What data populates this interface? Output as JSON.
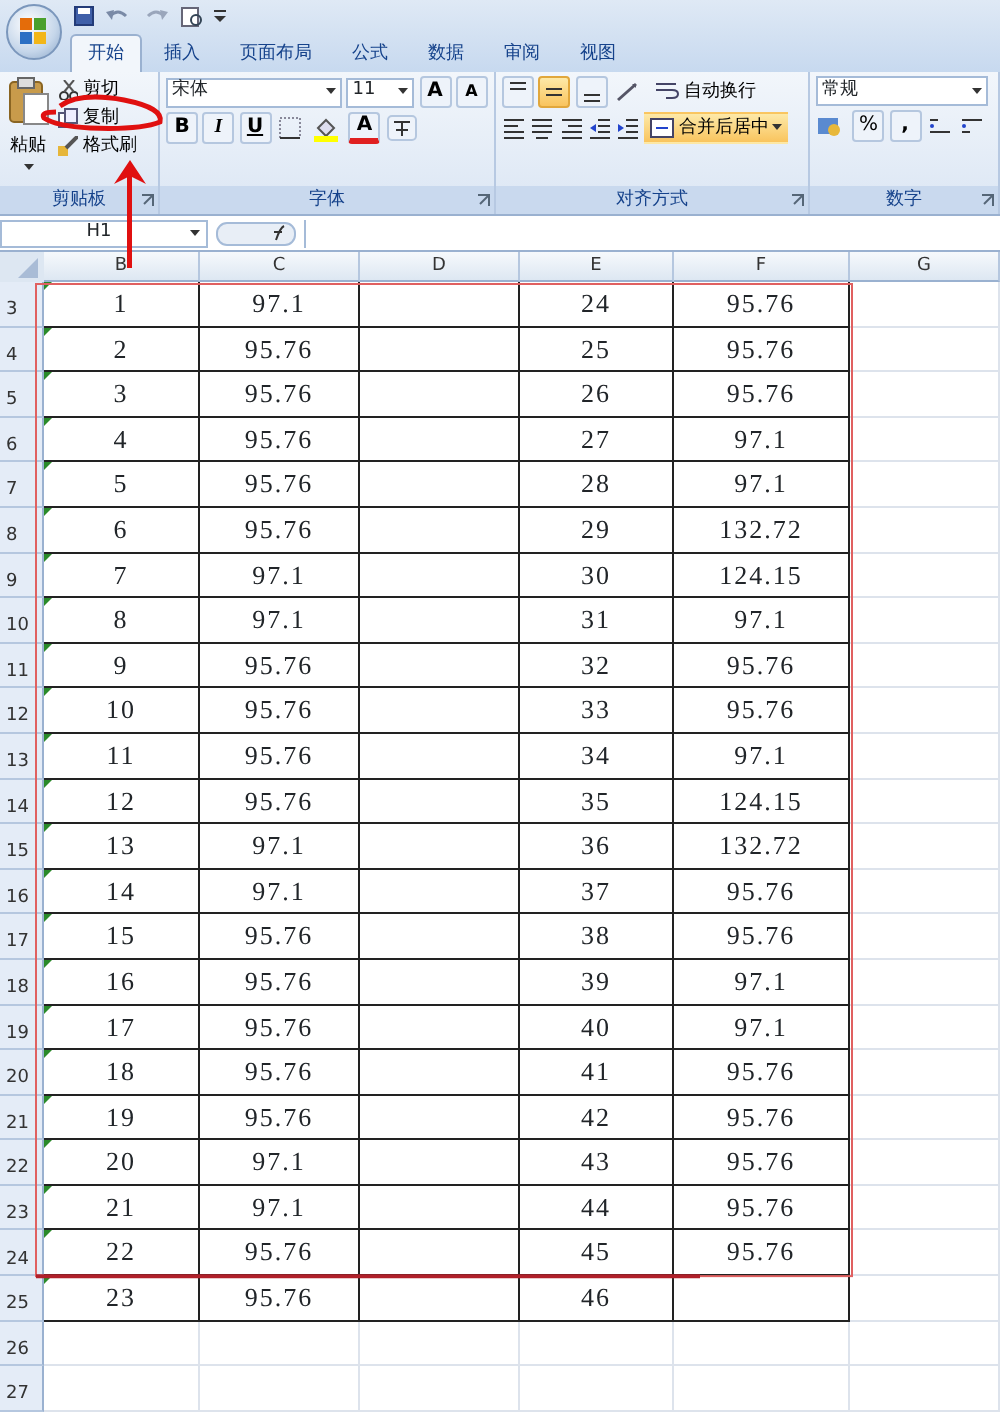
{
  "tabs": [
    {
      "label": "开始",
      "selected": true
    },
    {
      "label": "插入",
      "selected": false
    },
    {
      "label": "页面布局",
      "selected": false
    },
    {
      "label": "公式",
      "selected": false
    },
    {
      "label": "数据",
      "selected": false
    },
    {
      "label": "审阅",
      "selected": false
    },
    {
      "label": "视图",
      "selected": false
    }
  ],
  "ribbon": {
    "clipboard": {
      "label": "剪贴板",
      "paste": "粘贴",
      "cut": "剪切",
      "copy": "复制",
      "format_painter": "格式刷"
    },
    "font": {
      "label": "字体",
      "font_name": "宋体",
      "font_size": "11",
      "grow_font": "A",
      "shrink_font": "A",
      "bold": "B",
      "italic": "I",
      "underline": "U",
      "font_color": "A"
    },
    "alignment": {
      "label": "对齐方式",
      "vertical": [
        {
          "selected": false
        },
        {
          "selected": true
        },
        {
          "selected": false
        }
      ],
      "wrap_text": "自动换行",
      "merge": {
        "label": "合并后居中",
        "selected": true
      }
    },
    "number": {
      "label": "数字",
      "format": "常规",
      "percent": "%",
      "comma": ","
    }
  },
  "formula_bar": {
    "name_box": "H1"
  },
  "sheet": {
    "columns": [
      "B",
      "C",
      "D",
      "E",
      "F",
      "G"
    ],
    "rows": [
      {
        "number": "3",
        "b": "1",
        "c": "97.1",
        "e": "24",
        "f": "95.76"
      },
      {
        "number": "4",
        "b": "2",
        "c": "95.76",
        "e": "25",
        "f": "95.76"
      },
      {
        "number": "5",
        "b": "3",
        "c": "95.76",
        "e": "26",
        "f": "95.76"
      },
      {
        "number": "6",
        "b": "4",
        "c": "95.76",
        "e": "27",
        "f": "97.1"
      },
      {
        "number": "7",
        "b": "5",
        "c": "95.76",
        "e": "28",
        "f": "97.1"
      },
      {
        "number": "8",
        "b": "6",
        "c": "95.76",
        "e": "29",
        "f": "132.72"
      },
      {
        "number": "9",
        "b": "7",
        "c": "97.1",
        "e": "30",
        "f": "124.15"
      },
      {
        "number": "10",
        "b": "8",
        "c": "97.1",
        "e": "31",
        "f": "97.1"
      },
      {
        "number": "11",
        "b": "9",
        "c": "95.76",
        "e": "32",
        "f": "95.76"
      },
      {
        "number": "12",
        "b": "10",
        "c": "95.76",
        "e": "33",
        "f": "95.76"
      },
      {
        "number": "13",
        "b": "11",
        "c": "95.76",
        "e": "34",
        "f": "97.1"
      },
      {
        "number": "14",
        "b": "12",
        "c": "95.76",
        "e": "35",
        "f": "124.15"
      },
      {
        "number": "15",
        "b": "13",
        "c": "97.1",
        "e": "36",
        "f": "132.72"
      },
      {
        "number": "16",
        "b": "14",
        "c": "97.1",
        "e": "37",
        "f": "95.76"
      },
      {
        "number": "17",
        "b": "15",
        "c": "95.76",
        "e": "38",
        "f": "95.76"
      },
      {
        "number": "18",
        "b": "16",
        "c": "95.76",
        "e": "39",
        "f": "97.1"
      },
      {
        "number": "19",
        "b": "17",
        "c": "95.76",
        "e": "40",
        "f": "97.1"
      },
      {
        "number": "20",
        "b": "18",
        "c": "95.76",
        "e": "41",
        "f": "95.76"
      },
      {
        "number": "21",
        "b": "19",
        "c": "95.76",
        "e": "42",
        "f": "95.76"
      },
      {
        "number": "22",
        "b": "20",
        "c": "97.1",
        "e": "43",
        "f": "95.76"
      },
      {
        "number": "23",
        "b": "21",
        "c": "97.1",
        "e": "44",
        "f": "95.76"
      },
      {
        "number": "24",
        "b": "22",
        "c": "95.76",
        "e": "45",
        "f": "95.76"
      },
      {
        "number": "25",
        "b": "23",
        "c": "95.76",
        "e": "46"
      },
      {
        "number": "26"
      },
      {
        "number": "27"
      }
    ]
  }
}
